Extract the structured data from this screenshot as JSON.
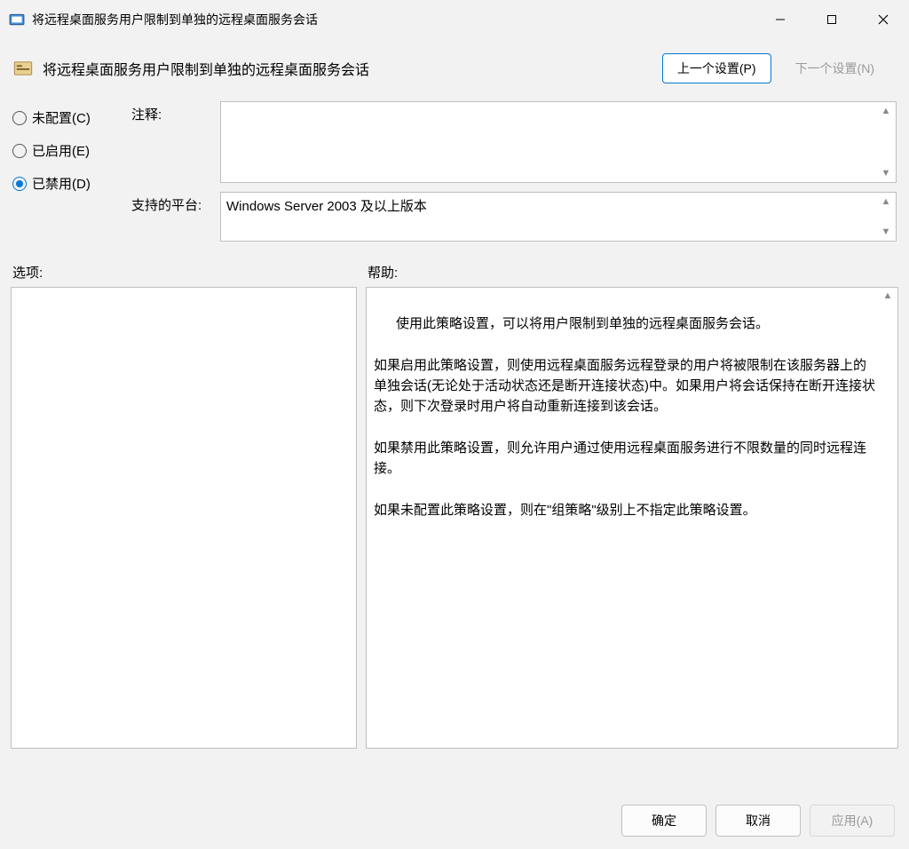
{
  "window": {
    "title": "将远程桌面服务用户限制到单独的远程桌面服务会话"
  },
  "header": {
    "title": "将远程桌面服务用户限制到单独的远程桌面服务会话",
    "prev_button": "上一个设置(P)",
    "next_button": "下一个设置(N)"
  },
  "state": {
    "selected": "disabled",
    "options": {
      "not_configured": "未配置(C)",
      "enabled": "已启用(E)",
      "disabled": "已禁用(D)"
    }
  },
  "fields": {
    "comment_label": "注释:",
    "comment_value": "",
    "platform_label": "支持的平台:",
    "platform_value": "Windows Server 2003 及以上版本"
  },
  "section_labels": {
    "options": "选项:",
    "help": "帮助:"
  },
  "help_text": "使用此策略设置，可以将用户限制到单独的远程桌面服务会话。\n\n如果启用此策略设置，则使用远程桌面服务远程登录的用户将被限制在该服务器上的单独会话(无论处于活动状态还是断开连接状态)中。如果用户将会话保持在断开连接状态，则下次登录时用户将自动重新连接到该会话。\n\n如果禁用此策略设置，则允许用户通过使用远程桌面服务进行不限数量的同时远程连接。\n\n如果未配置此策略设置，则在\"组策略\"级别上不指定此策略设置。",
  "buttons": {
    "ok": "确定",
    "cancel": "取消",
    "apply": "应用(A)"
  }
}
